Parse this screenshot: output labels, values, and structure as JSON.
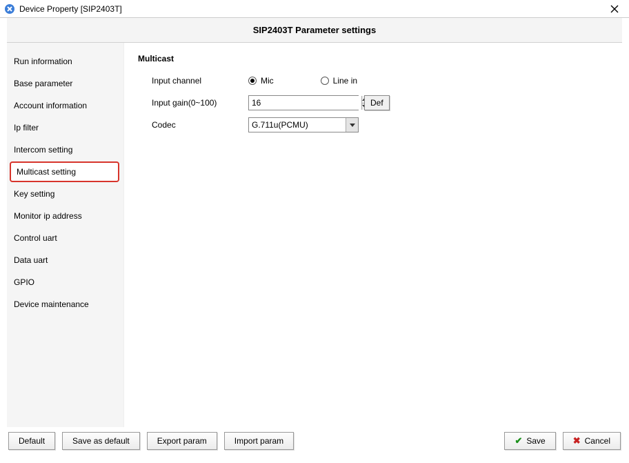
{
  "window": {
    "title": "Device Property [SIP2403T]"
  },
  "header": {
    "page_title": "SIP2403T Parameter settings"
  },
  "sidebar": {
    "items": [
      {
        "label": "Run information"
      },
      {
        "label": "Base parameter"
      },
      {
        "label": "Account information"
      },
      {
        "label": "Ip filter"
      },
      {
        "label": "Intercom setting"
      },
      {
        "label": "Multicast setting"
      },
      {
        "label": "Key setting"
      },
      {
        "label": "Monitor ip address"
      },
      {
        "label": "Control uart"
      },
      {
        "label": "Data uart"
      },
      {
        "label": "GPIO"
      },
      {
        "label": "Device maintenance"
      }
    ],
    "selected_index": 5
  },
  "multicast": {
    "section_title": "Multicast",
    "input_channel_label": "Input channel",
    "radio_mic_label": "Mic",
    "radio_linein_label": "Line in",
    "input_channel_value": "Mic",
    "input_gain_label": "Input gain(0~100)",
    "input_gain_value": "16",
    "def_button_label": "Def",
    "codec_label": "Codec",
    "codec_value": "G.711u(PCMU)"
  },
  "footer": {
    "default_label": "Default",
    "save_as_default_label": "Save as default",
    "export_label": "Export param",
    "import_label": "Import param",
    "save_label": "Save",
    "cancel_label": "Cancel"
  }
}
